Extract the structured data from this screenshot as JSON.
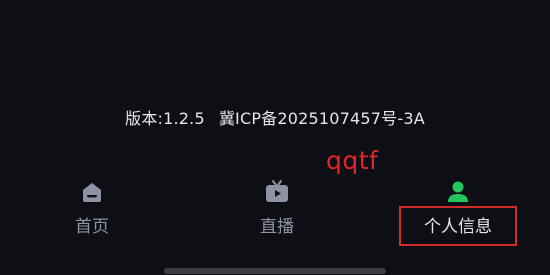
{
  "footer": {
    "version_label": "版本:1.2.5",
    "icp_label": "冀ICP备2025107457号-3A"
  },
  "watermark": {
    "text": "qqtf",
    "color": "#e0262b"
  },
  "tabbar": {
    "tabs": [
      {
        "label": "首页",
        "icon": "home-icon",
        "active": false
      },
      {
        "label": "直播",
        "icon": "tv-icon",
        "active": false
      },
      {
        "label": "个人信息",
        "icon": "person-icon",
        "active": true
      }
    ]
  },
  "colors": {
    "background": "#0e0f15",
    "tab_icon_inactive": "#8e93a3",
    "tab_icon_active": "#22c55e",
    "highlight": "#d02a2a"
  }
}
